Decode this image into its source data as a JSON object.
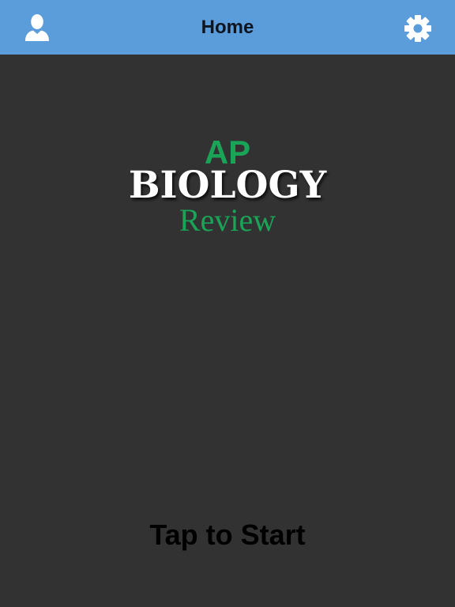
{
  "header": {
    "title": "Home",
    "left_icon": "person-icon",
    "right_icon": "gear-icon"
  },
  "logo": {
    "line1": "AP",
    "line2": "BIOLOGY",
    "line3": "Review"
  },
  "main": {
    "tap_label": "Tap to Start"
  },
  "colors": {
    "header_bg": "#5b9ddb",
    "page_bg": "#323232",
    "accent_green": "#1aa457",
    "icon_white": "#ffffff"
  }
}
